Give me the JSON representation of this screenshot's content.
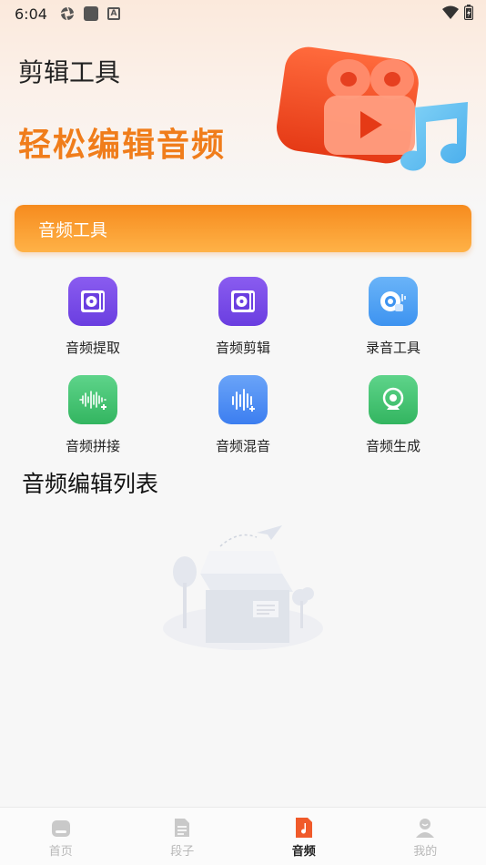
{
  "status_bar": {
    "time": "6:04"
  },
  "header": {
    "title": "剪辑工具",
    "slogan": "轻松编辑音频"
  },
  "tool_section": {
    "title": "音频工具",
    "tools": [
      {
        "label": "音频提取",
        "icon": "audio-extract-icon",
        "color": "#7b4fe8"
      },
      {
        "label": "音频剪辑",
        "icon": "audio-cut-icon",
        "color": "#7b4fe8"
      },
      {
        "label": "录音工具",
        "icon": "recorder-icon",
        "color": "#4da3f5"
      },
      {
        "label": "音频拼接",
        "icon": "audio-join-icon",
        "color": "#3ec46d"
      },
      {
        "label": "音频混音",
        "icon": "audio-mix-icon",
        "color": "#4d8ef5"
      },
      {
        "label": "音频生成",
        "icon": "audio-generate-icon",
        "color": "#3ec46d"
      }
    ]
  },
  "list_section": {
    "title": "音频编辑列表"
  },
  "bottom_nav": {
    "active": "音频",
    "items": [
      {
        "label": "首页",
        "icon": "home-icon"
      },
      {
        "label": "段子",
        "icon": "document-icon"
      },
      {
        "label": "音频",
        "icon": "audio-file-icon"
      },
      {
        "label": "我的",
        "icon": "user-icon"
      }
    ]
  },
  "colors": {
    "accent": "#f07d1b",
    "banner_start": "#f68b1e",
    "banner_end": "#ffb247"
  }
}
